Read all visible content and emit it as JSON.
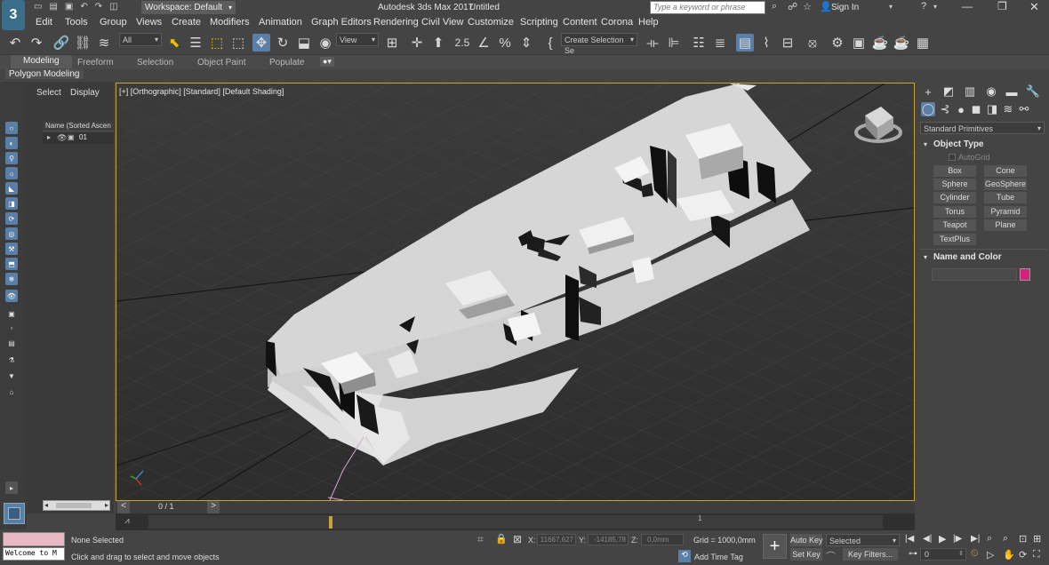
{
  "titlebar": {
    "app_title": "Autodesk 3ds Max 2017",
    "doc_title": "Untitled",
    "workspace": "Workspace: Default",
    "search_placeholder": "Type a keyword or phrase",
    "sign_in": "Sign In"
  },
  "menu": [
    "Edit",
    "Tools",
    "Group",
    "Views",
    "Create",
    "Modifiers",
    "Animation",
    "Graph Editors",
    "Rendering",
    "Civil View",
    "Customize",
    "Scripting",
    "Content",
    "Corona",
    "Help"
  ],
  "toolbar": {
    "filter_value": "All",
    "ref_coord_value": "View",
    "selection_set_value": "Create Selection Se",
    "snap_label": "2.5"
  },
  "ribbon": {
    "tabs": [
      "Modeling",
      "Freeform",
      "Selection",
      "Object Paint",
      "Populate"
    ],
    "subtab": "Polygon Modeling"
  },
  "explorer": {
    "tabs": [
      "Select",
      "Display"
    ],
    "column_header": "Name (Sorted Ascen",
    "items": [
      {
        "name": "01"
      }
    ]
  },
  "viewport": {
    "label": "[+] [Orthographic] [Standard] [Default Shading]"
  },
  "command_panel": {
    "category": "Standard Primitives",
    "object_type_title": "Object Type",
    "autogrid": "AutoGrid",
    "buttons": [
      "Box",
      "Cone",
      "Sphere",
      "GeoSphere",
      "Cylinder",
      "Tube",
      "Torus",
      "Pyramid",
      "Teapot",
      "Plane",
      "TextPlus"
    ],
    "name_color_title": "Name and Color",
    "name_value": "",
    "swatch_color": "#d4217c"
  },
  "timeslider": {
    "frame_label": "0 / 1",
    "track_marker": "1"
  },
  "status": {
    "maxscript": "Welcome to M",
    "selection": "None Selected",
    "prompt": "Click and drag to select and move objects",
    "x_label": "X:",
    "x_value": "11667,627",
    "y_label": "Y:",
    "y_value": "-14185,78",
    "z_label": "Z:",
    "z_value": "0,0mm",
    "grid": "Grid = 1000,0mm",
    "add_time_tag": "Add Time Tag",
    "auto_key": "Auto Key",
    "selected_value": "Selected",
    "set_key": "Set Key",
    "key_filters": "Key Filters...",
    "frame_value": "0"
  },
  "colors": {
    "viewport_border": "#c7a437",
    "accent_blue": "#5a7fa6",
    "panel_bg": "#444444"
  }
}
